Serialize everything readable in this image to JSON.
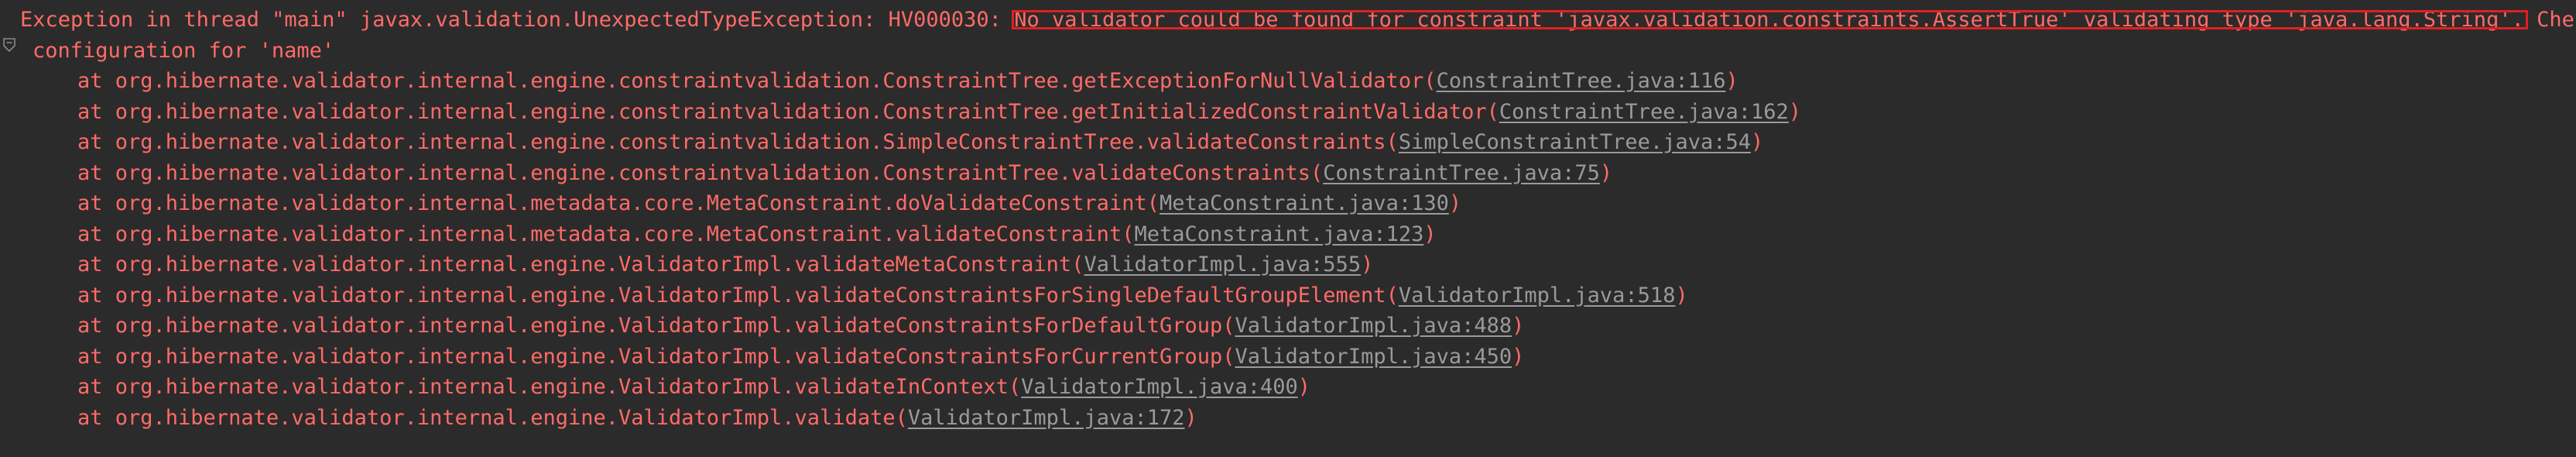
{
  "console": {
    "background_color": "#2b2b2b",
    "error_text_color": "#ff6b68",
    "link_color": "#9a9a9a",
    "annotation_color": "#e02020",
    "gutter_icon": "fold-marker-icon"
  },
  "exception": {
    "header_part1": "Exception in thread \"main\" javax.validation.UnexpectedTypeException: HV000030: ",
    "header_highlight": "No validator could be found for constraint 'javax.validation.constraints.AssertTrue' validating type 'java.lang.String'.",
    "header_part2": " Check",
    "header_wrap": "configuration for 'name'"
  },
  "stack_frames": [
    {
      "call": "at org.hibernate.validator.internal.engine.constraintvalidation.ConstraintTree.getExceptionForNullValidator",
      "link": "ConstraintTree.java:116"
    },
    {
      "call": "at org.hibernate.validator.internal.engine.constraintvalidation.ConstraintTree.getInitializedConstraintValidator",
      "link": "ConstraintTree.java:162"
    },
    {
      "call": "at org.hibernate.validator.internal.engine.constraintvalidation.SimpleConstraintTree.validateConstraints",
      "link": "SimpleConstraintTree.java:54"
    },
    {
      "call": "at org.hibernate.validator.internal.engine.constraintvalidation.ConstraintTree.validateConstraints",
      "link": "ConstraintTree.java:75"
    },
    {
      "call": "at org.hibernate.validator.internal.metadata.core.MetaConstraint.doValidateConstraint",
      "link": "MetaConstraint.java:130"
    },
    {
      "call": "at org.hibernate.validator.internal.metadata.core.MetaConstraint.validateConstraint",
      "link": "MetaConstraint.java:123"
    },
    {
      "call": "at org.hibernate.validator.internal.engine.ValidatorImpl.validateMetaConstraint",
      "link": "ValidatorImpl.java:555"
    },
    {
      "call": "at org.hibernate.validator.internal.engine.ValidatorImpl.validateConstraintsForSingleDefaultGroupElement",
      "link": "ValidatorImpl.java:518"
    },
    {
      "call": "at org.hibernate.validator.internal.engine.ValidatorImpl.validateConstraintsForDefaultGroup",
      "link": "ValidatorImpl.java:488"
    },
    {
      "call": "at org.hibernate.validator.internal.engine.ValidatorImpl.validateConstraintsForCurrentGroup",
      "link": "ValidatorImpl.java:450"
    },
    {
      "call": "at org.hibernate.validator.internal.engine.ValidatorImpl.validateInContext",
      "link": "ValidatorImpl.java:400"
    },
    {
      "call": "at org.hibernate.validator.internal.engine.ValidatorImpl.validate",
      "link": "ValidatorImpl.java:172"
    }
  ]
}
